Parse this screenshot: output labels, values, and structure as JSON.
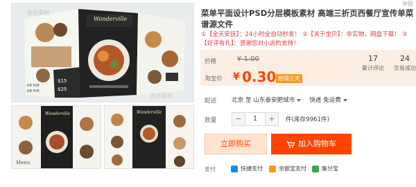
{
  "corner_label": "举报",
  "gallery": {
    "watermark": "图虫素材",
    "main": {
      "brand_script": "Wonderville",
      "price_tags": [
        "$15",
        "$25"
      ],
      "price_labels": [
        "RB PVE",
        "RB PVE"
      ]
    },
    "thumb1": {
      "brand_script": "Wonderville",
      "menu_label": "Menu"
    },
    "thumb2": {
      "brand_script": "Wonderville"
    }
  },
  "product": {
    "title": "菜单平面设计PSD分层模板素材 高端三折页西餐厅宣传单菜谱源文件",
    "subtitle": "①【全天安抚】：24小时全自动秒发！ ②【关于宝贝】：非实物，网盘下载！ ③【好评有礼】：感谢您对小店的支持！"
  },
  "price": {
    "label": "价格",
    "original": "¥ 1.00",
    "taobao_label": "淘宝价",
    "currency": "¥",
    "current": "0.30",
    "promo": "拍得三天",
    "reviews_count": "17",
    "reviews_label": "累计评论",
    "sales_count": "24",
    "sales_label": "交易成功"
  },
  "shipping": {
    "label": "配送",
    "from": "北京",
    "to_word": "至",
    "destination": "山东泰安肥城市",
    "method": "快递 免运费"
  },
  "quantity": {
    "label": "数量",
    "minus": "−",
    "value": "1",
    "plus": "+",
    "unit_stock": "件(库存9961件)"
  },
  "actions": {
    "buy_now": "立即购买",
    "add_cart": "加入购物车"
  },
  "payment": {
    "label": "支付",
    "methods": [
      "快捷支付",
      "余额宝支付",
      "集分宝"
    ]
  },
  "colors": {
    "accent": "#ff4400",
    "price_bg": "#fdeee4",
    "promo_bg": "#f39a1e",
    "alert_red": "#e4393c"
  }
}
